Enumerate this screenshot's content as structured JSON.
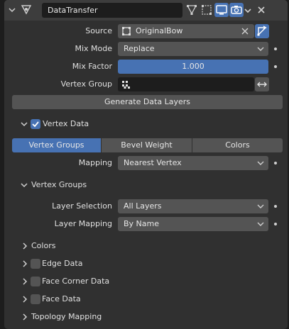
{
  "header": {
    "name_value": "DataTransfer"
  },
  "source": {
    "label": "Source",
    "value": "OriginalBow"
  },
  "mix_mode": {
    "label": "Mix Mode",
    "value": "Replace"
  },
  "mix_factor": {
    "label": "Mix Factor",
    "value": "1.000",
    "fraction": 1.0
  },
  "vertex_group": {
    "label": "Vertex Group",
    "value": ""
  },
  "generate_button": "Generate Data Layers",
  "vertex_data": {
    "label": "Vertex Data",
    "enabled": true,
    "tabs": [
      "Vertex Groups",
      "Bevel Weight",
      "Colors"
    ],
    "active_tab": "Vertex Groups",
    "mapping_label": "Mapping",
    "mapping_value": "Nearest Vertex"
  },
  "vertex_groups_panel": {
    "title": "Vertex Groups",
    "layer_selection_label": "Layer Selection",
    "layer_selection_value": "All Layers",
    "layer_mapping_label": "Layer Mapping",
    "layer_mapping_value": "By Name"
  },
  "sections": {
    "colors": "Colors",
    "edge_data": "Edge Data",
    "face_corner_data": "Face Corner Data",
    "face_data": "Face Data",
    "topology_mapping": "Topology Mapping"
  },
  "colors": {
    "accent": "#4772b3",
    "panel": "#303030",
    "field": "#545454",
    "field_dark": "#1d1d1d"
  }
}
